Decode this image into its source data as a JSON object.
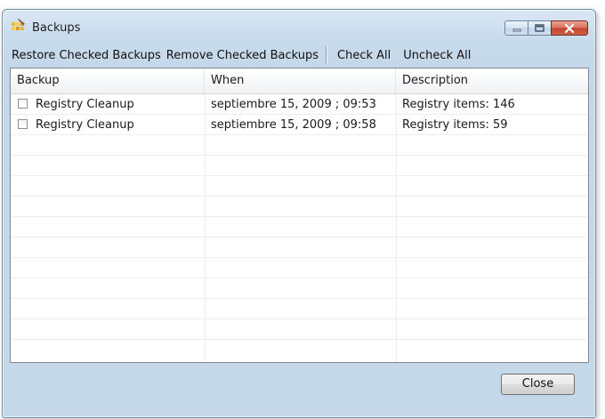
{
  "window": {
    "title": "Backups"
  },
  "menu": {
    "restore": "Restore Checked Backups",
    "remove": "Remove Checked Backups",
    "check_all": "Check All",
    "uncheck_all": "Uncheck All"
  },
  "table": {
    "columns": [
      "Backup",
      "When",
      "Description"
    ],
    "rows": [
      {
        "checked": false,
        "backup": "Registry Cleanup",
        "when": "septiembre 15, 2009 ;  09:53",
        "description": "Registry items: 146"
      },
      {
        "checked": false,
        "backup": "Registry Cleanup",
        "when": "septiembre 15, 2009 ;  09:58",
        "description": "Registry items: 59"
      }
    ]
  },
  "buttons": {
    "close": "Close"
  },
  "icons": [
    "app-icon",
    "minimize-icon",
    "maximize-icon",
    "close-icon"
  ],
  "colors": {
    "close_caption": "#c3422a",
    "window_frame": "#c5d8ea"
  }
}
